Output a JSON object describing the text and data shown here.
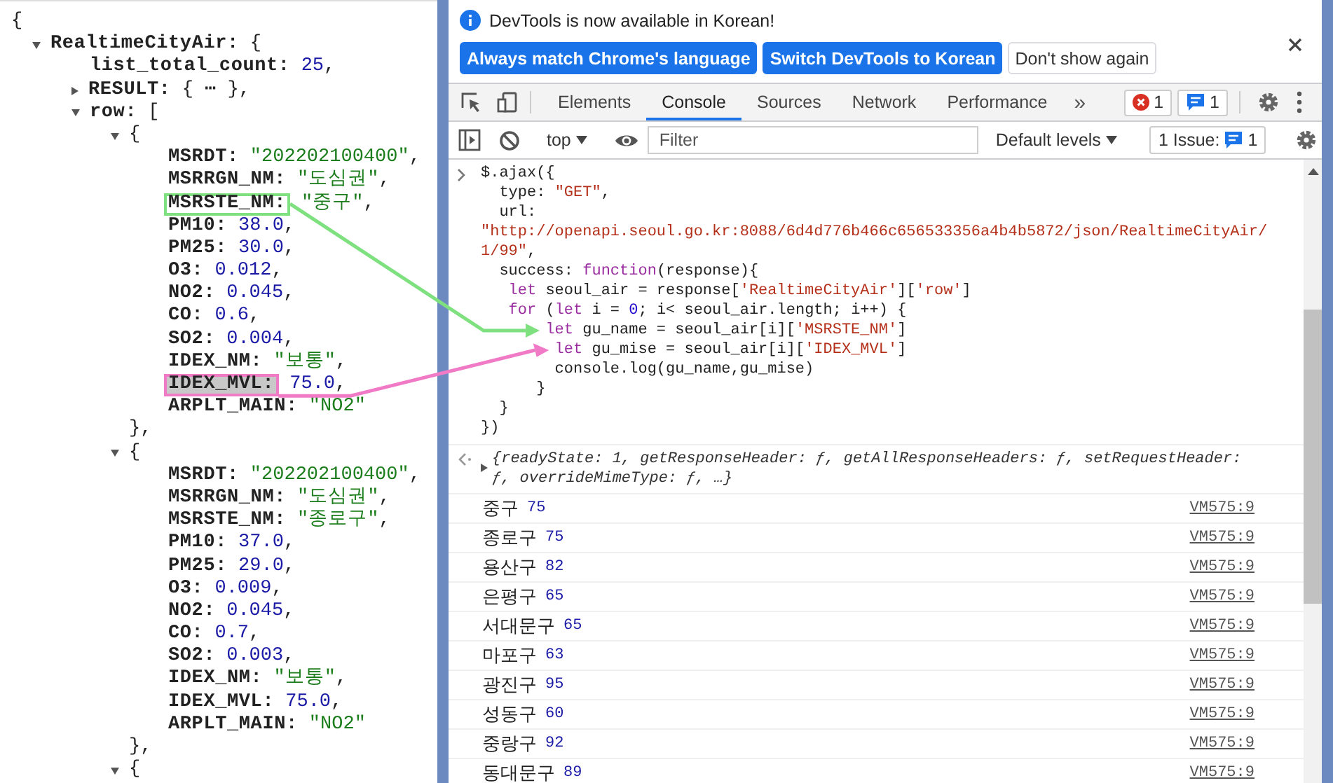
{
  "json_viewer": {
    "root": {
      "open": "{",
      "children": [
        {
          "key": "RealtimeCityAir:",
          "expanded": true,
          "open": "{",
          "children": [
            {
              "key": "list_total_count:",
              "value": "25",
              "kind": "number",
              "tail": ","
            },
            {
              "key": "RESULT:",
              "expanded": false,
              "value": "{ ⋯ }",
              "kind": "collapsed",
              "tail": ","
            },
            {
              "key": "row:",
              "expanded": true,
              "open": "[",
              "children": [
                {
                  "expanded": true,
                  "open": "{",
                  "close": "},",
                  "children": [
                    {
                      "key": "MSRDT:",
                      "value": "\"202202100400\"",
                      "kind": "string",
                      "tail": ","
                    },
                    {
                      "key": "MSRRGN_NM:",
                      "value": "\"도심권\"",
                      "kind": "string",
                      "tail": ","
                    },
                    {
                      "key": "MSRSTE_NM:",
                      "value": "\"중구\"",
                      "kind": "string",
                      "tail": ",",
                      "annotation": {
                        "color": "#7ee07e",
                        "shaded": false,
                        "kind": "elbow"
                      }
                    },
                    {
                      "key": "PM10:",
                      "value": "38.0",
                      "kind": "number",
                      "tail": ","
                    },
                    {
                      "key": "PM25:",
                      "value": "30.0",
                      "kind": "number",
                      "tail": ","
                    },
                    {
                      "key": "O3:",
                      "value": "0.012",
                      "kind": "number",
                      "tail": ","
                    },
                    {
                      "key": "NO2:",
                      "value": "0.045",
                      "kind": "number",
                      "tail": ","
                    },
                    {
                      "key": "CO:",
                      "value": "0.6",
                      "kind": "number",
                      "tail": ","
                    },
                    {
                      "key": "SO2:",
                      "value": "0.004",
                      "kind": "number",
                      "tail": ","
                    },
                    {
                      "key": "IDEX_NM:",
                      "value": "\"보통\"",
                      "kind": "string",
                      "tail": ","
                    },
                    {
                      "key": "IDEX_MVL:",
                      "value": "75.0",
                      "kind": "number",
                      "tail": ",",
                      "annotation": {
                        "color": "#f07ac6",
                        "shaded": true,
                        "kind": "straight"
                      }
                    },
                    {
                      "key": "ARPLT_MAIN:",
                      "value": "\"NO2\"",
                      "kind": "string"
                    }
                  ]
                },
                {
                  "expanded": true,
                  "open": "{",
                  "close": "},",
                  "children": [
                    {
                      "key": "MSRDT:",
                      "value": "\"202202100400\"",
                      "kind": "string",
                      "tail": ","
                    },
                    {
                      "key": "MSRRGN_NM:",
                      "value": "\"도심권\"",
                      "kind": "string",
                      "tail": ","
                    },
                    {
                      "key": "MSRSTE_NM:",
                      "value": "\"종로구\"",
                      "kind": "string",
                      "tail": ","
                    },
                    {
                      "key": "PM10:",
                      "value": "37.0",
                      "kind": "number",
                      "tail": ","
                    },
                    {
                      "key": "PM25:",
                      "value": "29.0",
                      "kind": "number",
                      "tail": ","
                    },
                    {
                      "key": "O3:",
                      "value": "0.009",
                      "kind": "number",
                      "tail": ","
                    },
                    {
                      "key": "NO2:",
                      "value": "0.045",
                      "kind": "number",
                      "tail": ","
                    },
                    {
                      "key": "CO:",
                      "value": "0.7",
                      "kind": "number",
                      "tail": ","
                    },
                    {
                      "key": "SO2:",
                      "value": "0.003",
                      "kind": "number",
                      "tail": ","
                    },
                    {
                      "key": "IDEX_NM:",
                      "value": "\"보통\"",
                      "kind": "string",
                      "tail": ","
                    },
                    {
                      "key": "IDEX_MVL:",
                      "value": "75.0",
                      "kind": "number",
                      "tail": ","
                    },
                    {
                      "key": "ARPLT_MAIN:",
                      "value": "\"NO2\"",
                      "kind": "string"
                    }
                  ]
                },
                {
                  "expanded": true,
                  "open": "{"
                }
              ]
            }
          ]
        }
      ]
    }
  },
  "devtools": {
    "infobar": {
      "message": "DevTools is now available in Korean!",
      "buttons": [
        {
          "label": "Always match Chrome's language",
          "kind": "primary"
        },
        {
          "label": "Switch DevTools to Korean",
          "kind": "primary"
        },
        {
          "label": "Don't show again",
          "kind": "secondary"
        }
      ]
    },
    "tabs": [
      {
        "label": "Elements",
        "selected": false
      },
      {
        "label": "Console",
        "selected": true
      },
      {
        "label": "Sources",
        "selected": false
      },
      {
        "label": "Network",
        "selected": false
      },
      {
        "label": "Performance",
        "selected": false
      }
    ],
    "more_tabs": "»",
    "error_count": "1",
    "message_count": "1",
    "console_toolbar": {
      "context": "top",
      "filter_placeholder": "Filter",
      "levels": "Default levels",
      "issues_label": "1 Issue:",
      "issues_count": "1"
    },
    "console": {
      "input": [
        [
          {
            "t": "$.ajax({",
            "kind": "plain"
          }
        ],
        [
          {
            "t": "  type: ",
            "kind": "plain"
          },
          {
            "t": "\"GET\"",
            "kind": "string"
          },
          {
            "t": ",",
            "kind": "plain"
          }
        ],
        [
          {
            "t": "  url:",
            "kind": "plain"
          }
        ],
        [
          {
            "t": "\"http://openapi.seoul.go.kr:8088/6d4d776b466c656533356a4b4b5872/json/RealtimeCityAir/",
            "kind": "string"
          }
        ],
        [
          {
            "t": "1/99\"",
            "kind": "string"
          },
          {
            "t": ",",
            "kind": "plain"
          }
        ],
        [
          {
            "t": "  success: ",
            "kind": "plain"
          },
          {
            "t": "function",
            "kind": "keyword"
          },
          {
            "t": "(response){",
            "kind": "plain"
          }
        ],
        [
          {
            "t": "   let",
            "kind": "keyword"
          },
          {
            "t": " seoul_air = response[",
            "kind": "plain"
          },
          {
            "t": "'RealtimeCityAir'",
            "kind": "string"
          },
          {
            "t": "][",
            "kind": "plain"
          },
          {
            "t": "'row'",
            "kind": "string"
          },
          {
            "t": "]",
            "kind": "plain"
          }
        ],
        [
          {
            "t": "   for",
            "kind": "keyword"
          },
          {
            "t": " (",
            "kind": "plain"
          },
          {
            "t": "let",
            "kind": "keyword"
          },
          {
            "t": " i = ",
            "kind": "plain"
          },
          {
            "t": "0",
            "kind": "number"
          },
          {
            "t": "; i< seoul_air.length; i++) {",
            "kind": "plain"
          }
        ],
        [
          {
            "t": "       let",
            "kind": "keyword",
            "arrow_target": true
          },
          {
            "t": " gu_name = seoul_air[i][",
            "kind": "plain"
          },
          {
            "t": "'MSRSTE_NM'",
            "kind": "string"
          },
          {
            "t": "]",
            "kind": "plain"
          }
        ],
        [
          {
            "t": "        let",
            "kind": "keyword",
            "arrow_target": true
          },
          {
            "t": " gu_mise = seoul_air[i][",
            "kind": "plain"
          },
          {
            "t": "'IDEX_MVL'",
            "kind": "string"
          },
          {
            "t": "]",
            "kind": "plain"
          }
        ],
        [
          {
            "t": "        console.log(gu_name,gu_mise)",
            "kind": "plain"
          }
        ],
        [
          {
            "t": "      }",
            "kind": "plain"
          }
        ],
        [
          {
            "t": "  }",
            "kind": "plain"
          }
        ],
        [
          {
            "t": "})",
            "kind": "plain"
          }
        ]
      ],
      "result": {
        "text": "{readyState: 1, getResponseHeader: ƒ, getAllResponseHeaders: ƒ, setRequestHeader: ƒ, overrideMimeType: ƒ, …}",
        "expanded": false
      },
      "logs": [
        {
          "name": "중구",
          "value": "75",
          "source": "VM575:9"
        },
        {
          "name": "종로구",
          "value": "75",
          "source": "VM575:9"
        },
        {
          "name": "용산구",
          "value": "82",
          "source": "VM575:9"
        },
        {
          "name": "은평구",
          "value": "65",
          "source": "VM575:9"
        },
        {
          "name": "서대문구",
          "value": "65",
          "source": "VM575:9"
        },
        {
          "name": "마포구",
          "value": "63",
          "source": "VM575:9"
        },
        {
          "name": "광진구",
          "value": "95",
          "source": "VM575:9"
        },
        {
          "name": "성동구",
          "value": "60",
          "source": "VM575:9"
        },
        {
          "name": "중랑구",
          "value": "92",
          "source": "VM575:9"
        },
        {
          "name": "동대문구",
          "value": "89",
          "source": "VM575:9"
        }
      ]
    }
  }
}
